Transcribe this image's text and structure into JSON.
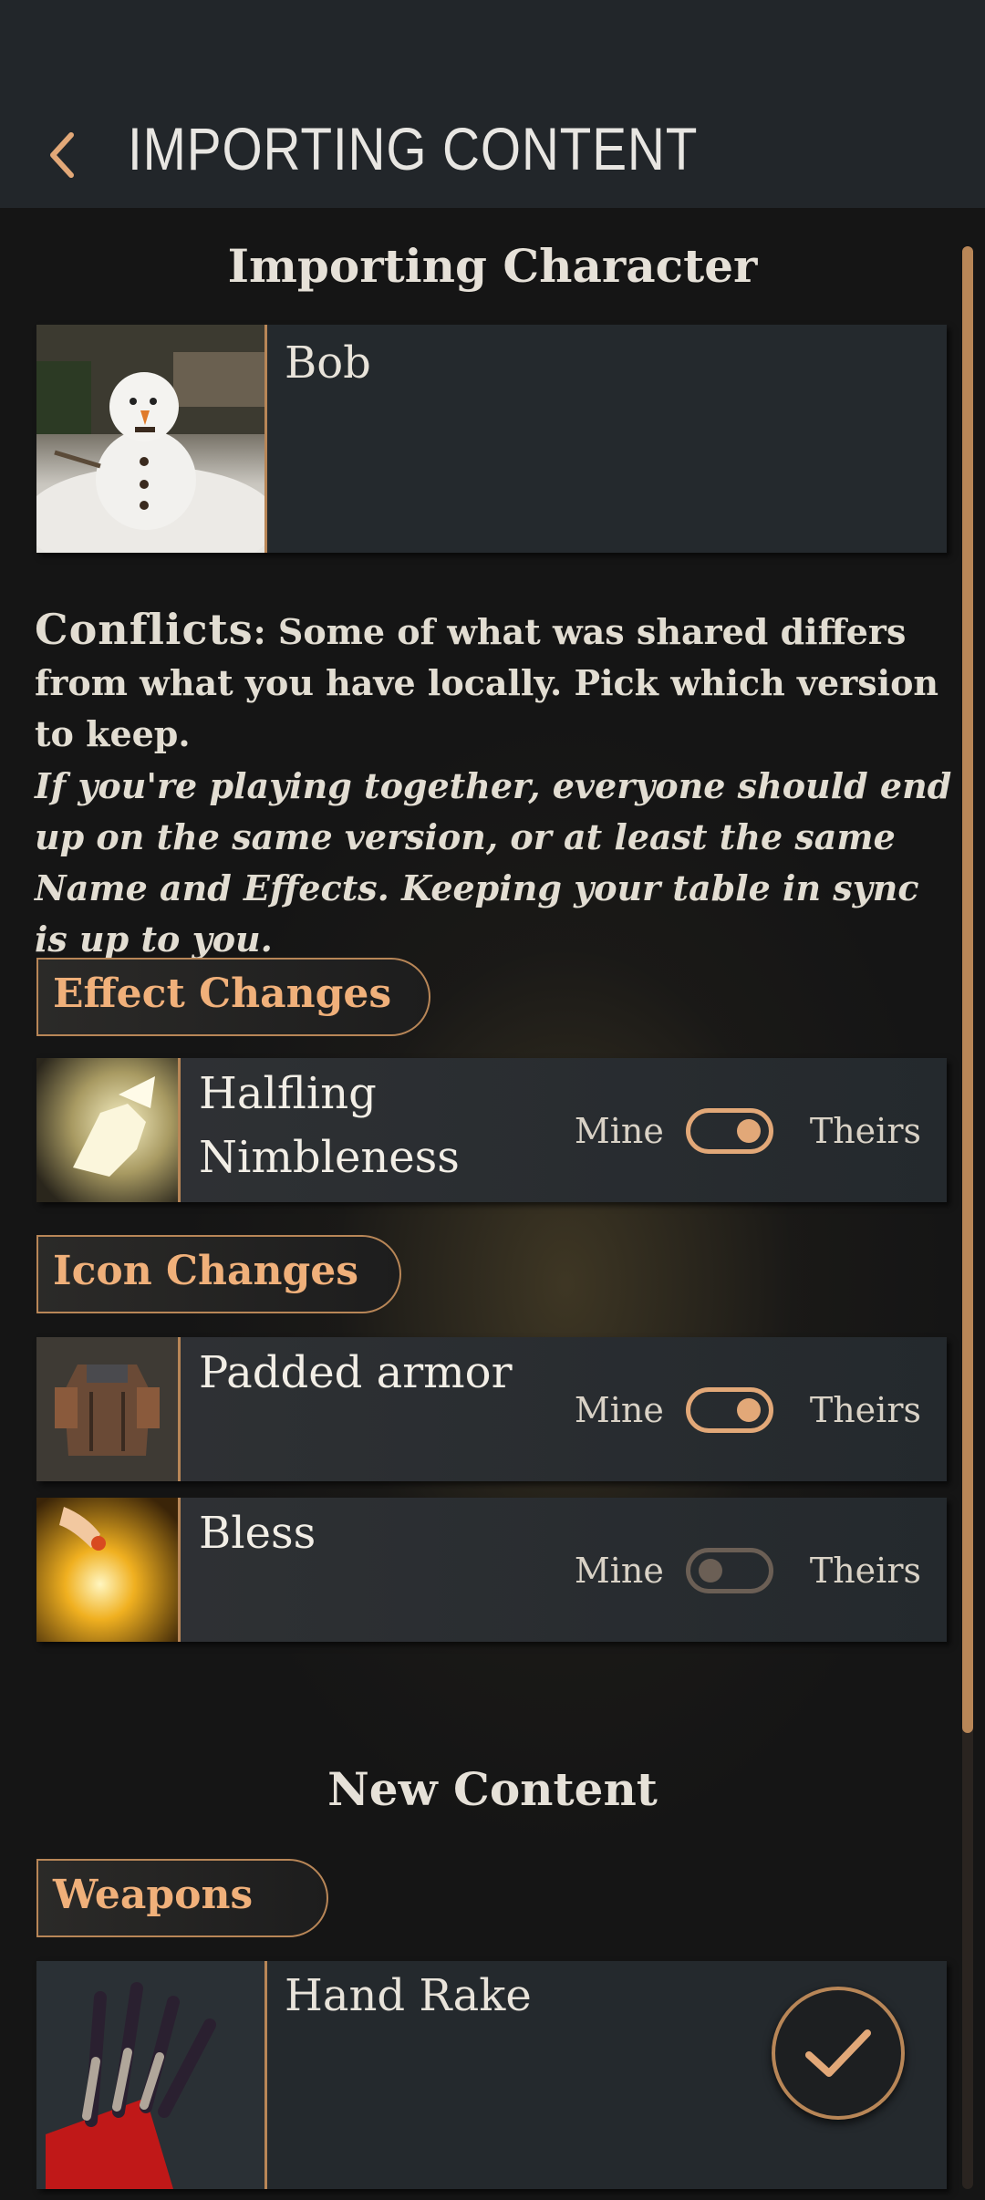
{
  "header": {
    "title": "IMPORTING CONTENT",
    "back_icon": "chevron-left-icon"
  },
  "importing": {
    "section_title": "Importing Character",
    "character": {
      "name": "Bob"
    }
  },
  "conflicts": {
    "lead": "Conflicts",
    "text": ": Some of what was shared differs from what you have locally. Pick which version to keep.",
    "note": "If you're playing together, everyone should end up on the same version, or at least the same Name and Effects. Keeping your table in sync is up to you."
  },
  "effect_changes": {
    "label": "Effect Changes",
    "items": [
      {
        "name": "Halfling Nimbleness",
        "mine_label": "Mine",
        "theirs_label": "Theirs",
        "choice": "theirs"
      }
    ]
  },
  "icon_changes": {
    "label": "Icon Changes",
    "items": [
      {
        "name": "Padded armor",
        "mine_label": "Mine",
        "theirs_label": "Theirs",
        "choice": "theirs"
      },
      {
        "name": "Bless",
        "mine_label": "Mine",
        "theirs_label": "Theirs",
        "choice": "mine"
      }
    ]
  },
  "new_content": {
    "section_title": "New Content",
    "weapons": {
      "label": "Weapons",
      "items": [
        {
          "name": "Hand Rake"
        }
      ]
    }
  },
  "confirm_icon": "checkmark-icon",
  "colors": {
    "accent": "#b88657",
    "accent_light": "#f0b07a",
    "header_bg": "#22262a",
    "card_bg": "#24292d"
  }
}
